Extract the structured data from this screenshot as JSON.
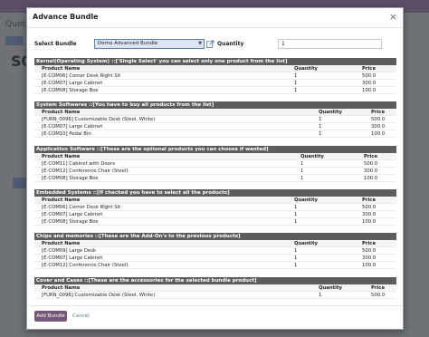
{
  "background": {
    "title": "Quota",
    "record": "S0"
  },
  "modal": {
    "title": "Advance Bundle",
    "close_symbol": "×",
    "select_bundle_label": "Select Bundle",
    "bundle_value": "Demo Advanced Bundle",
    "quantity_label": "Quantity",
    "quantity_value": "1"
  },
  "sections": [
    {
      "header": "Kernel(Operating System) ::['Single Select' you can select only one product from the list]",
      "columns": [
        "Product Name",
        "Quantity",
        "Price"
      ],
      "rows": [
        [
          "[E-COM06] Corner Desk Right Sit",
          "1",
          "500.0"
        ],
        [
          "[E-COM07] Large Cabinet",
          "1",
          "300.0"
        ],
        [
          "[E-COM08] Storage Box",
          "1",
          "100.0"
        ]
      ]
    },
    {
      "header": "System Softwares ::[You have to buy all products from the list]",
      "columns": [
        "Product Name",
        "Quantity",
        "Price"
      ],
      "rows": [
        [
          "[FURN_0096] Customizable Desk (Steel, White)",
          "1",
          "500.0"
        ],
        [
          "[E-COM07] Large Cabinet",
          "1",
          "300.0"
        ],
        [
          "[E-COM10] Pedal Bin",
          "1",
          "100.0"
        ]
      ]
    },
    {
      "header": "Application Software ::[These are the optional products you can choose if wanted]",
      "columns": [
        "Product Name",
        "Quantity",
        "Price"
      ],
      "rows": [
        [
          "[E-COM11] Cabinet with Doors",
          "1",
          "500.0"
        ],
        [
          "[E-COM12] Conference Chair (Steel)",
          "1",
          "300.0"
        ],
        [
          "[E-COM08] Storage Box",
          "1",
          "100.0"
        ]
      ]
    },
    {
      "header": "Embedded Systems ::[If checked you have to select all the products]",
      "columns": [
        "Product Name",
        "Quantity",
        "Price"
      ],
      "rows": [
        [
          "[E-COM06] Corner Desk Right Sit",
          "1",
          "500.0"
        ],
        [
          "[E-COM07] Large Cabinet",
          "1",
          "300.0"
        ],
        [
          "[E-COM08] Storage Box",
          "1",
          "100.0"
        ]
      ]
    },
    {
      "header": "Chips and memories ::[These are the Add-On's to the previous products]",
      "columns": [
        "Product Name",
        "Quantity",
        "Price"
      ],
      "rows": [
        [
          "[E-COM09] Large Desk",
          "1",
          "500.0"
        ],
        [
          "[E-COM07] Large Cabinet",
          "1",
          "300.0"
        ],
        [
          "[E-COM12] Conference Chair (Steel)",
          "1",
          "100.0"
        ]
      ]
    },
    {
      "header": "Cover and Cases ::[These are the accessories for the selected bundle product]",
      "columns": [
        "Product Name",
        "Quantity",
        "Price"
      ],
      "rows": [
        [
          "[FURN_0096] Customizable Desk (Steel, White)",
          "1",
          "500.0"
        ]
      ]
    }
  ],
  "footer": {
    "add_bundle_label": "Add Bundle",
    "cancel_label": "Cancel"
  },
  "colors": {
    "section_header_bg": "#5d5d5d",
    "primary_button": "#76587a",
    "select_border": "#5b7fb5"
  }
}
